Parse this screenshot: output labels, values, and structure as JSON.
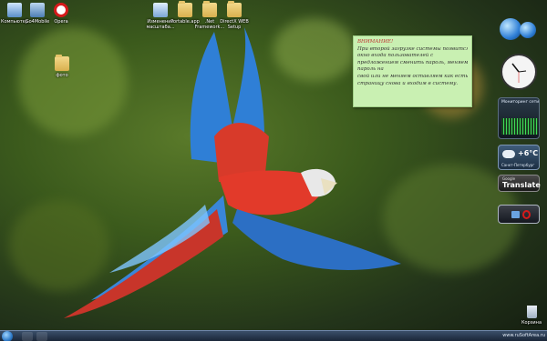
{
  "desktop": {
    "icons": [
      {
        "label": "Компьютер",
        "glyph": "computer-icon"
      },
      {
        "label": "Go4Mobile",
        "glyph": "monitor-icon"
      },
      {
        "label": "Opera",
        "glyph": "opera-icon"
      },
      {
        "label": "Изменение масштаба...",
        "glyph": "shortcut-icon"
      },
      {
        "label": "Portable.app",
        "glyph": "folder-icon"
      },
      {
        "label": ".Net Framework...",
        "glyph": "folder-icon"
      },
      {
        "label": "DirectX WEB Setup",
        "glyph": "folder-icon"
      },
      {
        "label": "фото",
        "glyph": "folder-icon"
      },
      {
        "label": "Корзина",
        "glyph": "recycle-bin-icon"
      }
    ]
  },
  "note": {
    "lines": [
      "ВНИМАНИЕ!",
      "При второй загрузке системы появится",
      "окно входа пользователей с",
      "предложением сменить пароль, меняем",
      "пароль на",
      "свой или не меняем оставляем как есть",
      "страницу снова и входим в систему."
    ]
  },
  "gadgets": {
    "net_title": "Мониторинг сети",
    "weather_temp": "+6°C",
    "weather_city": "Санкт-Петербург",
    "translate_brand": "Google",
    "translate_label": "Translate"
  },
  "watermark": "www.ruSoftArea.ru"
}
